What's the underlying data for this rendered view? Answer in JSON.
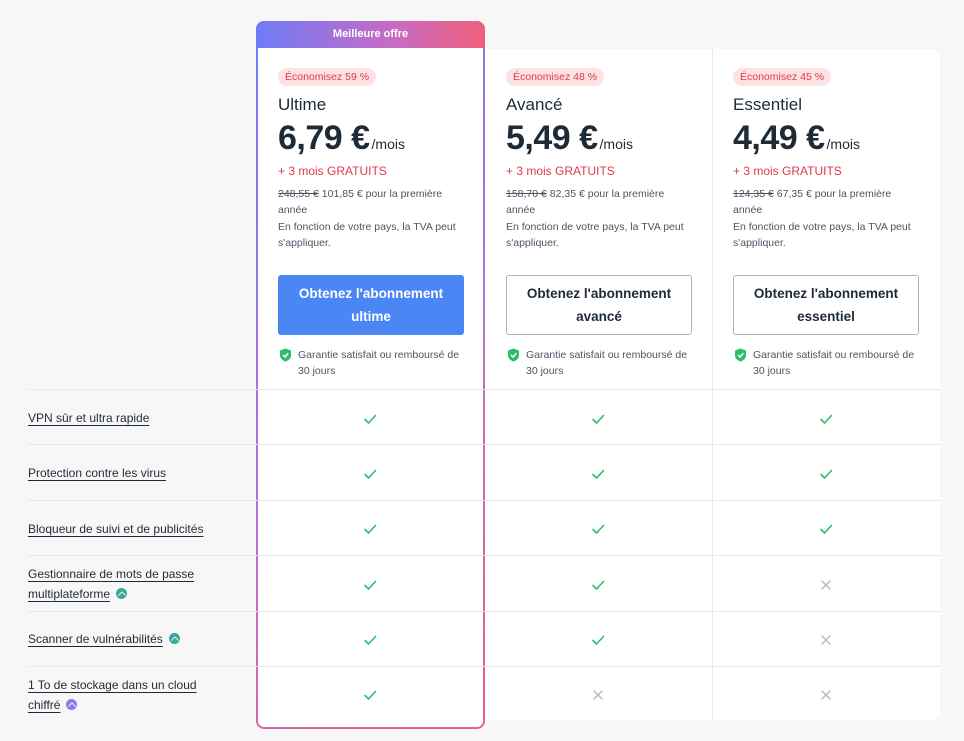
{
  "banner": {
    "label": "Meilleure offre"
  },
  "plans": [
    {
      "badge": "Économisez 59 %",
      "name": "Ultime",
      "price": "6,79 €",
      "per": "/mois",
      "bonus": "+ 3 mois GRATUITS",
      "original_price": "248,55 €",
      "intro_price": "101,85 € pour la première année",
      "vat_note": "En fonction de votre pays, la TVA peut s'appliquer.",
      "cta": "Obtenez l'abonnement ultime",
      "guarantee": "Garantie satisfait ou remboursé de 30 jours"
    },
    {
      "badge": "Économisez 48 %",
      "name": "Avancé",
      "price": "5,49 €",
      "per": "/mois",
      "bonus": "+ 3 mois GRATUITS",
      "original_price": "158,70 €",
      "intro_price": "82,35 € pour la première année",
      "vat_note": "En fonction de votre pays, la TVA peut s'appliquer.",
      "cta": "Obtenez l'abonnement avancé",
      "guarantee": "Garantie satisfait ou remboursé de 30 jours"
    },
    {
      "badge": "Économisez 45 %",
      "name": "Essentiel",
      "price": "4,49 €",
      "per": "/mois",
      "bonus": "+ 3 mois GRATUITS",
      "original_price": "124,35 €",
      "intro_price": "67,35 € pour la première année",
      "vat_note": "En fonction de votre pays, la TVA peut s'appliquer.",
      "cta": "Obtenez l'abonnement essentiel",
      "guarantee": "Garantie satisfait ou remboursé de 30 jours"
    }
  ],
  "features": [
    {
      "label": "VPN sûr et ultra rapide",
      "info": "",
      "included": [
        true,
        true,
        true
      ]
    },
    {
      "label": "Protection contre les virus",
      "info": "",
      "included": [
        true,
        true,
        true
      ]
    },
    {
      "label": "Bloqueur de suivi et de publicités",
      "info": "",
      "included": [
        true,
        true,
        true
      ]
    },
    {
      "label": "Gestionnaire de mots de passe multiplateforme",
      "info": "teal",
      "included": [
        true,
        true,
        false
      ]
    },
    {
      "label": "Scanner de vulnérabilités",
      "info": "teal",
      "included": [
        true,
        true,
        false
      ]
    },
    {
      "label": "1 To de stockage dans un cloud chiffré",
      "info": "purple",
      "included": [
        true,
        false,
        false
      ]
    }
  ],
  "colors": {
    "accent_blue": "#4a87f5",
    "savings_red": "#e0394d",
    "check_green": "#2ebd6b",
    "cross_gray": "#b8bcc3",
    "shield_green": "#2ebd6b"
  },
  "icons": {
    "included": "check-icon",
    "excluded": "cross-icon",
    "guarantee": "shield-check-icon",
    "info": "info-chevron-icon"
  }
}
